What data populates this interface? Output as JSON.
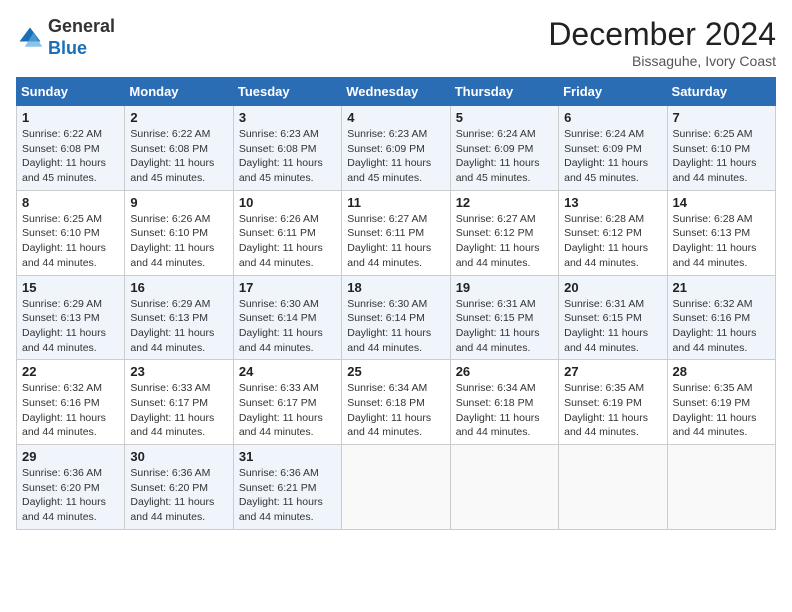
{
  "header": {
    "logo_general": "General",
    "logo_blue": "Blue",
    "month_title": "December 2024",
    "location": "Bissaguhe, Ivory Coast"
  },
  "weekdays": [
    "Sunday",
    "Monday",
    "Tuesday",
    "Wednesday",
    "Thursday",
    "Friday",
    "Saturday"
  ],
  "weeks": [
    [
      {
        "day": "1",
        "sunrise": "6:22 AM",
        "sunset": "6:08 PM",
        "daylight": "11 hours and 45 minutes."
      },
      {
        "day": "2",
        "sunrise": "6:22 AM",
        "sunset": "6:08 PM",
        "daylight": "11 hours and 45 minutes."
      },
      {
        "day": "3",
        "sunrise": "6:23 AM",
        "sunset": "6:08 PM",
        "daylight": "11 hours and 45 minutes."
      },
      {
        "day": "4",
        "sunrise": "6:23 AM",
        "sunset": "6:09 PM",
        "daylight": "11 hours and 45 minutes."
      },
      {
        "day": "5",
        "sunrise": "6:24 AM",
        "sunset": "6:09 PM",
        "daylight": "11 hours and 45 minutes."
      },
      {
        "day": "6",
        "sunrise": "6:24 AM",
        "sunset": "6:09 PM",
        "daylight": "11 hours and 45 minutes."
      },
      {
        "day": "7",
        "sunrise": "6:25 AM",
        "sunset": "6:10 PM",
        "daylight": "11 hours and 44 minutes."
      }
    ],
    [
      {
        "day": "8",
        "sunrise": "6:25 AM",
        "sunset": "6:10 PM",
        "daylight": "11 hours and 44 minutes."
      },
      {
        "day": "9",
        "sunrise": "6:26 AM",
        "sunset": "6:10 PM",
        "daylight": "11 hours and 44 minutes."
      },
      {
        "day": "10",
        "sunrise": "6:26 AM",
        "sunset": "6:11 PM",
        "daylight": "11 hours and 44 minutes."
      },
      {
        "day": "11",
        "sunrise": "6:27 AM",
        "sunset": "6:11 PM",
        "daylight": "11 hours and 44 minutes."
      },
      {
        "day": "12",
        "sunrise": "6:27 AM",
        "sunset": "6:12 PM",
        "daylight": "11 hours and 44 minutes."
      },
      {
        "day": "13",
        "sunrise": "6:28 AM",
        "sunset": "6:12 PM",
        "daylight": "11 hours and 44 minutes."
      },
      {
        "day": "14",
        "sunrise": "6:28 AM",
        "sunset": "6:13 PM",
        "daylight": "11 hours and 44 minutes."
      }
    ],
    [
      {
        "day": "15",
        "sunrise": "6:29 AM",
        "sunset": "6:13 PM",
        "daylight": "11 hours and 44 minutes."
      },
      {
        "day": "16",
        "sunrise": "6:29 AM",
        "sunset": "6:13 PM",
        "daylight": "11 hours and 44 minutes."
      },
      {
        "day": "17",
        "sunrise": "6:30 AM",
        "sunset": "6:14 PM",
        "daylight": "11 hours and 44 minutes."
      },
      {
        "day": "18",
        "sunrise": "6:30 AM",
        "sunset": "6:14 PM",
        "daylight": "11 hours and 44 minutes."
      },
      {
        "day": "19",
        "sunrise": "6:31 AM",
        "sunset": "6:15 PM",
        "daylight": "11 hours and 44 minutes."
      },
      {
        "day": "20",
        "sunrise": "6:31 AM",
        "sunset": "6:15 PM",
        "daylight": "11 hours and 44 minutes."
      },
      {
        "day": "21",
        "sunrise": "6:32 AM",
        "sunset": "6:16 PM",
        "daylight": "11 hours and 44 minutes."
      }
    ],
    [
      {
        "day": "22",
        "sunrise": "6:32 AM",
        "sunset": "6:16 PM",
        "daylight": "11 hours and 44 minutes."
      },
      {
        "day": "23",
        "sunrise": "6:33 AM",
        "sunset": "6:17 PM",
        "daylight": "11 hours and 44 minutes."
      },
      {
        "day": "24",
        "sunrise": "6:33 AM",
        "sunset": "6:17 PM",
        "daylight": "11 hours and 44 minutes."
      },
      {
        "day": "25",
        "sunrise": "6:34 AM",
        "sunset": "6:18 PM",
        "daylight": "11 hours and 44 minutes."
      },
      {
        "day": "26",
        "sunrise": "6:34 AM",
        "sunset": "6:18 PM",
        "daylight": "11 hours and 44 minutes."
      },
      {
        "day": "27",
        "sunrise": "6:35 AM",
        "sunset": "6:19 PM",
        "daylight": "11 hours and 44 minutes."
      },
      {
        "day": "28",
        "sunrise": "6:35 AM",
        "sunset": "6:19 PM",
        "daylight": "11 hours and 44 minutes."
      }
    ],
    [
      {
        "day": "29",
        "sunrise": "6:36 AM",
        "sunset": "6:20 PM",
        "daylight": "11 hours and 44 minutes."
      },
      {
        "day": "30",
        "sunrise": "6:36 AM",
        "sunset": "6:20 PM",
        "daylight": "11 hours and 44 minutes."
      },
      {
        "day": "31",
        "sunrise": "6:36 AM",
        "sunset": "6:21 PM",
        "daylight": "11 hours and 44 minutes."
      },
      null,
      null,
      null,
      null
    ]
  ]
}
